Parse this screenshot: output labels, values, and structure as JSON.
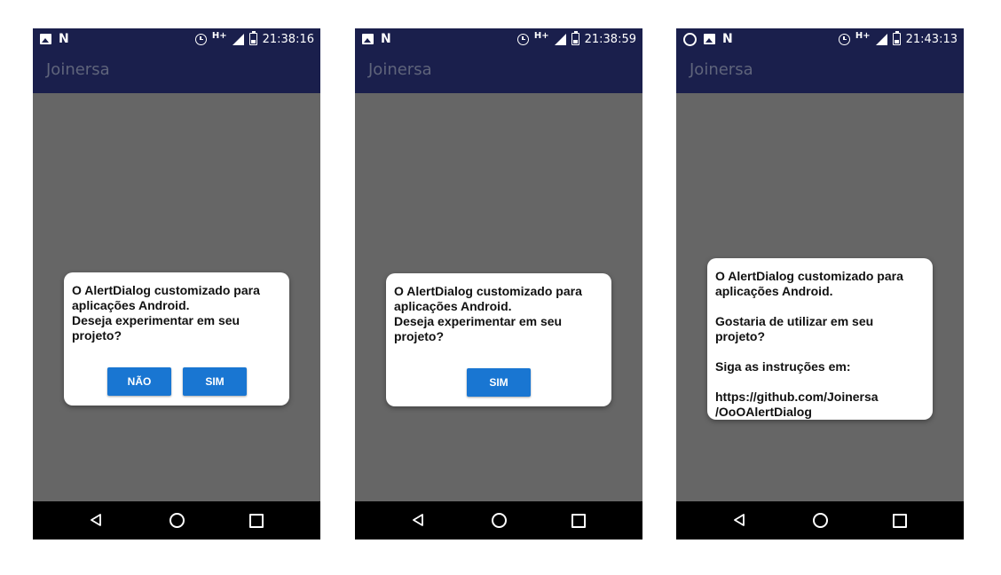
{
  "screens": [
    {
      "status_bar": {
        "left_icons": [
          "image-icon",
          "n-icon"
        ],
        "network": "H+",
        "time": "21:38:16"
      },
      "app_bar": {
        "title": "Joinersa"
      },
      "dialog": {
        "message": "O AlertDialog customizado para\naplicações Android.\nDeseja experimentar em seu\nprojeto?",
        "buttons": [
          "NÃO",
          "SIM"
        ]
      }
    },
    {
      "status_bar": {
        "left_icons": [
          "image-icon",
          "n-icon"
        ],
        "network": "H+",
        "time": "21:38:59"
      },
      "app_bar": {
        "title": "Joinersa"
      },
      "dialog": {
        "message": "O AlertDialog customizado para\naplicações Android.\nDeseja experimentar em seu\nprojeto?",
        "buttons": [
          "SIM"
        ]
      }
    },
    {
      "status_bar": {
        "left_icons": [
          "whatsapp-icon",
          "image-icon",
          "n-icon"
        ],
        "network": "H+",
        "time": "21:43:13"
      },
      "app_bar": {
        "title": "Joinersa"
      },
      "dialog": {
        "message": "O AlertDialog customizado para\naplicações Android.\n\nGostaria de utilizar em seu projeto?\n\nSiga as instruções em:\n\nhttps://github.com/Joinersa\n/OoOAlertDialog",
        "buttons": []
      }
    }
  ],
  "nav_bar": {
    "icons": [
      "back-icon",
      "home-icon",
      "recents-icon"
    ]
  },
  "colors": {
    "status_bar": "#1a1f4c",
    "app_bar": "#1a1f4c",
    "app_title": "#5f647b",
    "content_dim": "#666666",
    "nav_bar": "#000000",
    "dialog_bg": "#ffffff",
    "button": "#1976d2",
    "button_text": "#ffffff"
  }
}
